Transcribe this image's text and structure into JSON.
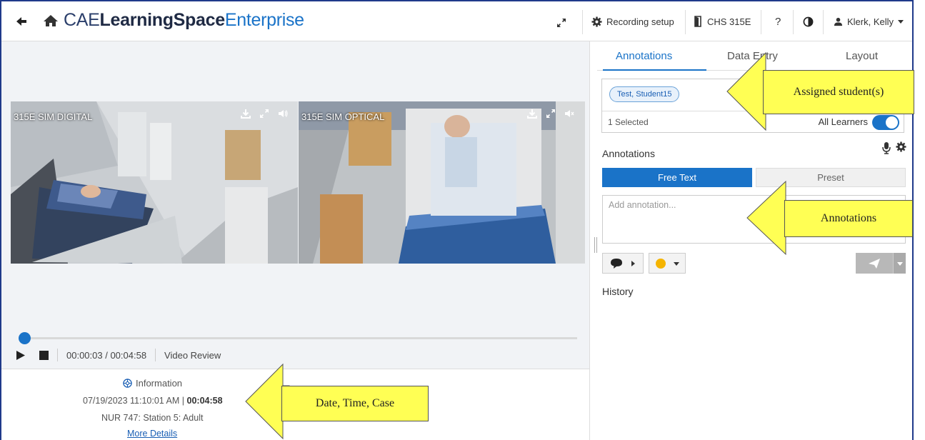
{
  "header": {
    "brand_prefix": "CAE",
    "brand_middle": "LearningSpace",
    "brand_suffix": "Enterprise",
    "recording_setup": "Recording setup",
    "room": "CHS 315E",
    "help": "?",
    "user": "Klerk, Kelly"
  },
  "videos": [
    {
      "label": "315E SIM DIGITAL"
    },
    {
      "label": "315E SIM OPTICAL"
    }
  ],
  "player": {
    "time": "00:00:03 / 00:04:58",
    "mode": "Video Review",
    "progress_percent": 1
  },
  "info": {
    "title": "Information",
    "datetime": "07/19/2023 11:10:01 AM",
    "separator": "|",
    "duration": "00:04:58",
    "case": "NUR 747: Station 5: Adult",
    "more_link": "More Details"
  },
  "panel": {
    "tabs": [
      "Annotations",
      "Data Entry",
      "Layout"
    ],
    "active_tab": 0,
    "learner_chip": "Test, Student15",
    "selected_count": "1 Selected",
    "all_learners": "All Learners",
    "annotations_title": "Annotations",
    "free_text": "Free Text",
    "preset": "Preset",
    "annotation_placeholder": "Add annotation...",
    "history": "History"
  },
  "callouts": {
    "assigned": "Assigned student(s)",
    "annotations": "Annotations",
    "date_time_case": "Date, Time, Case"
  },
  "colors": {
    "accent": "#1a73c8",
    "callout": "#ffff54",
    "border": "#1f3a8a"
  }
}
